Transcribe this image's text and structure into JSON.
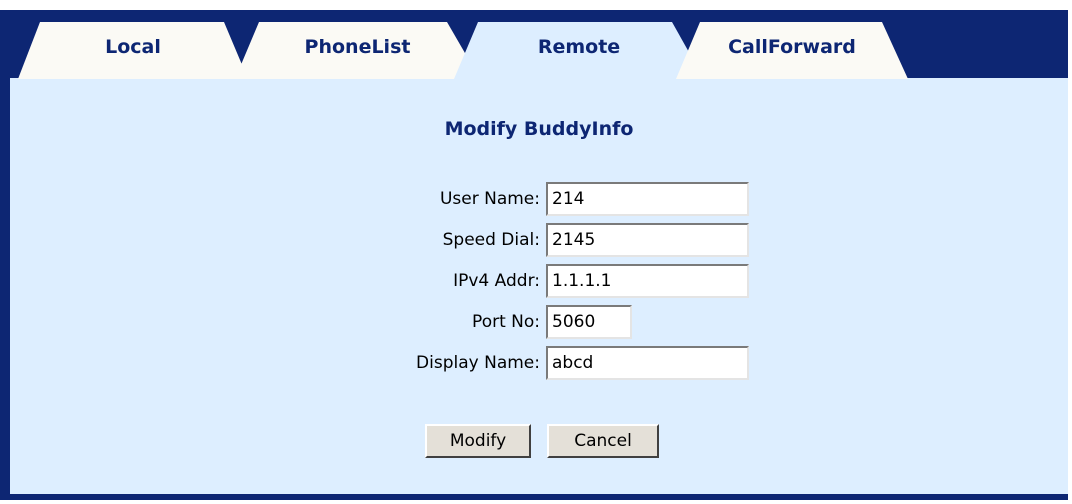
{
  "tabs": [
    {
      "label": "Local"
    },
    {
      "label": "PhoneList"
    },
    {
      "label": "Remote",
      "active": true
    },
    {
      "label": "CallForward"
    }
  ],
  "form": {
    "title": "Modify BuddyInfo",
    "fields": [
      {
        "label": "User Name:",
        "value": "214"
      },
      {
        "label": "Speed Dial:",
        "value": "2145"
      },
      {
        "label": "IPv4 Addr:",
        "value": "1.1.1.1"
      },
      {
        "label": "Port No:",
        "value": "5060"
      },
      {
        "label": "Display Name:",
        "value": "abcd"
      }
    ],
    "buttons": {
      "modify": "Modify",
      "cancel": "Cancel"
    }
  },
  "colors": {
    "frame": "#0d2673",
    "panel": "#ddeeff",
    "tab_active": "#ddeeff",
    "tab_inactive": "#fbfaf5",
    "text_heading": "#0d2673"
  }
}
